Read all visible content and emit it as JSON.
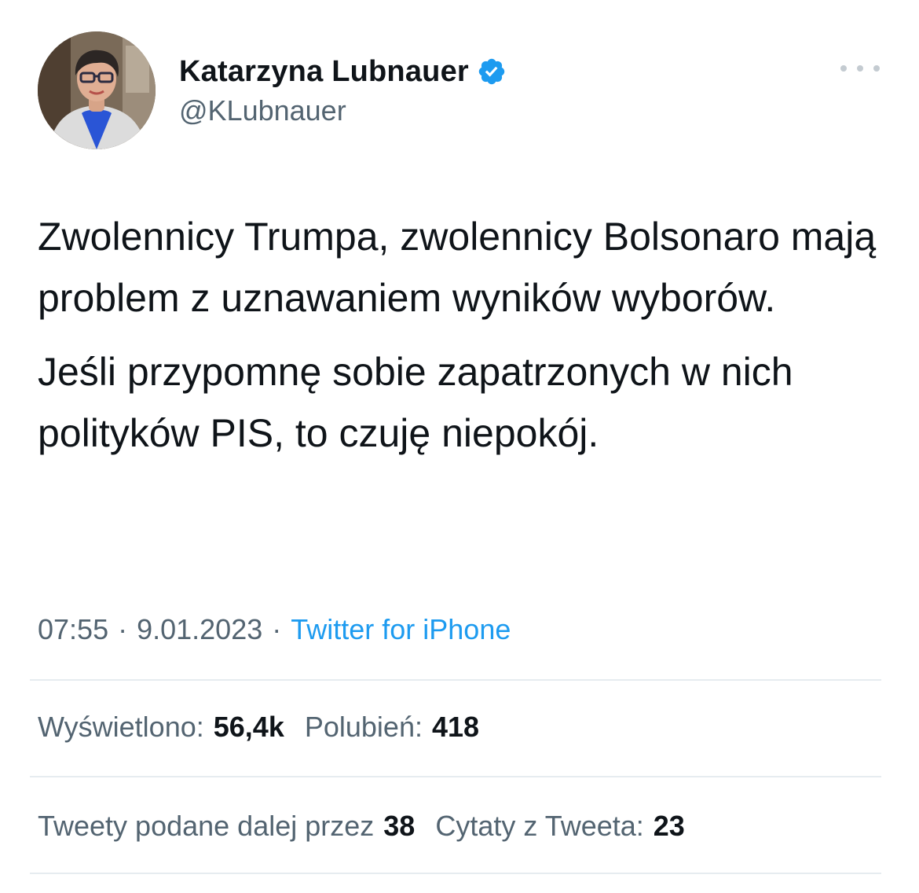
{
  "author": {
    "display_name": "Katarzyna Lubnauer",
    "handle": "@KLubnauer",
    "verified_icon": "verified-badge-icon",
    "avatar_icon": "profile-photo"
  },
  "tweet": {
    "paragraphs": [
      "Zwolennicy Trumpa, zwolennicy Bolsonaro mają problem z uznawaniem wyników wyborów.",
      "Jeśli przypomnę sobie zapatrzonych w nich polityków PIS, to czuję niepokój."
    ]
  },
  "meta": {
    "time": "07:55",
    "separator": "·",
    "date": "9.01.2023",
    "source": "Twitter for iPhone"
  },
  "stats": {
    "views_label": "Wyświetlono:",
    "views_value": "56,4k",
    "likes_label": "Polubień:",
    "likes_value": "418",
    "retweets_label": "Tweety podane dalej przez",
    "retweets_value": "38",
    "quotes_label": "Cytaty z Tweeta:",
    "quotes_value": "23"
  },
  "colors": {
    "text": "#0f1419",
    "muted": "#536471",
    "link": "#1d9bf0",
    "divider": "#e6ecf0"
  }
}
